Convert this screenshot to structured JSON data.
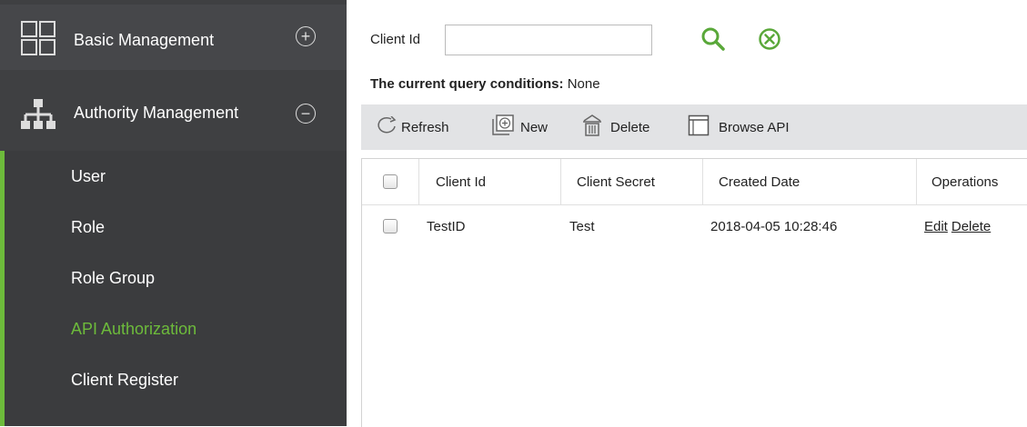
{
  "sidebar": {
    "groups": [
      {
        "label": "Basic Management",
        "icon": "grid-icon",
        "toggle": "⊕"
      },
      {
        "label": "Authority Management",
        "icon": "org-chart-icon",
        "toggle": "⊖"
      }
    ],
    "items": [
      {
        "label": "User"
      },
      {
        "label": "Role"
      },
      {
        "label": "Role Group"
      },
      {
        "label": "API Authorization",
        "active": true
      },
      {
        "label": "Client Register"
      }
    ],
    "accent_color": "#6dbb3b"
  },
  "search": {
    "label": "Client Id",
    "value": "",
    "placeholder": ""
  },
  "query": {
    "prefix": "The current query conditions:",
    "value": "None"
  },
  "toolbar": {
    "refresh": "Refresh",
    "new": "New",
    "delete": "Delete",
    "browse": "Browse API"
  },
  "table": {
    "columns": [
      "Client Id",
      "Client Secret",
      "Created Date",
      "Operations"
    ],
    "rows": [
      {
        "client_id": "TestID",
        "client_secret": "Test",
        "created": "2018-04-05 10:28:46",
        "edit": "Edit",
        "delete": "Delete"
      }
    ]
  }
}
